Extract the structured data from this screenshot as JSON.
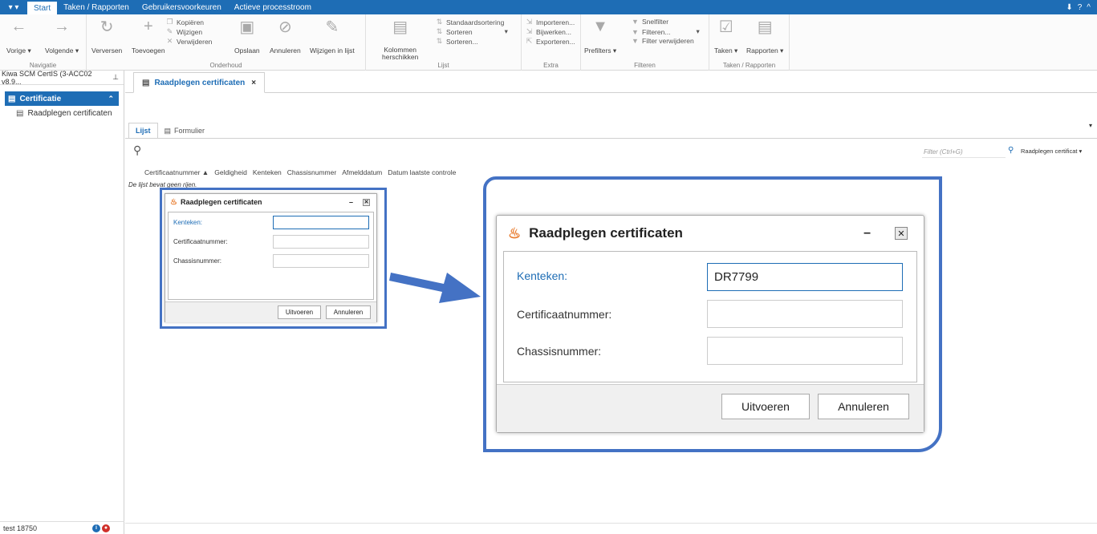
{
  "menubar": {
    "quick_access": "▾ ▾",
    "tabs": [
      "Start",
      "Taken / Rapporten",
      "Gebruikersvoorkeuren",
      "Actieve processtroom"
    ],
    "right": [
      "⬇",
      "?",
      "^"
    ]
  },
  "ribbon": {
    "navigatie": {
      "label": "Navigatie",
      "vorige": "Vorige ▾",
      "volgende": "Volgende ▾"
    },
    "onderhoud": {
      "label": "Onderhoud",
      "verversen": "Verversen",
      "toevoegen": "Toevoegen",
      "kopieren": "Kopiëren",
      "wijzigen": "Wijzigen",
      "verwijderen": "Verwijderen",
      "opslaan": "Opslaan",
      "annuleren": "Annuleren",
      "wijzigen_in_lijst": "Wijzigen in lijst"
    },
    "lijst": {
      "label": "Lijst",
      "kolommen_1": "Kolommen",
      "kolommen_2": "herschikken",
      "standaardsortering": "Standaardsortering",
      "sorteren": "Sorteren",
      "sorteren_dots": "Sorteren..."
    },
    "extra": {
      "label": "Extra",
      "importeren": "Importeren...",
      "bijwerken": "Bijwerken...",
      "exporteren": "Exporteren..."
    },
    "filteren": {
      "label": "Filteren",
      "prefilters": "Prefilters ▾",
      "snelfilter": "Snelfilter",
      "filteren": "Filteren...",
      "filter_verwijderen": "Filter verwijderen"
    },
    "taken_rapporten": {
      "label": "Taken / Rapporten",
      "taken": "Taken ▾",
      "rapporten": "Rapporten ▾"
    }
  },
  "leftpanel": {
    "title": "Kiwa SCM CertIS (3-ACC02 v8.9...",
    "section": "Certificatie",
    "items": [
      "Raadplegen certificaten"
    ],
    "status_user": "test 18750"
  },
  "doctab": {
    "label": "Raadplegen certificaten",
    "close": "×"
  },
  "subtabs": {
    "lijst": "Lijst",
    "formulier": "Formulier"
  },
  "filter": {
    "placeholder": "Filter (Ctrl+G)",
    "select": "Raadplegen certificat ▾"
  },
  "columns": [
    "Certificaatnummer ▲",
    "Geldigheid",
    "Kenteken",
    "Chassisnummer",
    "Afmelddatum",
    "Datum laatste controle"
  ],
  "empty_message": "De lijst bevat geen rijen.",
  "dialog": {
    "title": "Raadplegen certificaten",
    "fields": [
      {
        "label": "Kenteken:",
        "value": ""
      },
      {
        "label": "Certificaatnummer:",
        "value": ""
      },
      {
        "label": "Chassisnummer:",
        "value": ""
      }
    ],
    "ok": "Uitvoeren",
    "cancel": "Annuleren"
  },
  "dialog_zoomed": {
    "title": "Raadplegen certificaten",
    "fields": [
      {
        "label": "Kenteken:",
        "value": "DR7799"
      },
      {
        "label": "Certificaatnummer:",
        "value": ""
      },
      {
        "label": "Chassisnummer:",
        "value": ""
      }
    ],
    "ok": "Uitvoeren",
    "cancel": "Annuleren"
  },
  "colors": {
    "accent": "#1e6db5",
    "highlight_frame": "#4472c4",
    "label_blue": "#1e6db5"
  }
}
